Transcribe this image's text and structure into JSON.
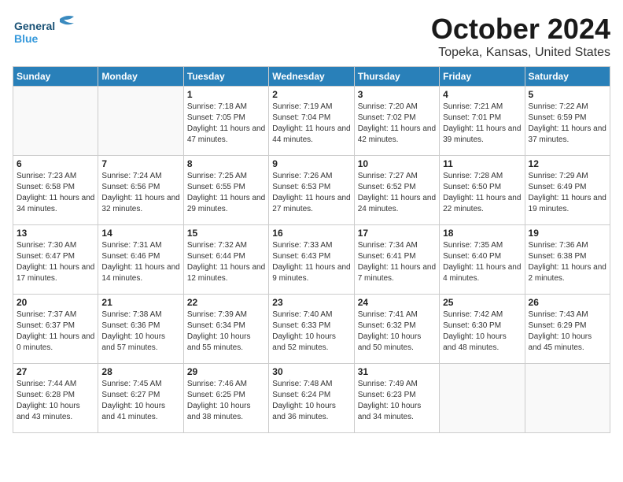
{
  "header": {
    "logo_line1": "General",
    "logo_line2": "Blue",
    "month": "October 2024",
    "location": "Topeka, Kansas, United States"
  },
  "weekdays": [
    "Sunday",
    "Monday",
    "Tuesday",
    "Wednesday",
    "Thursday",
    "Friday",
    "Saturday"
  ],
  "weeks": [
    [
      {
        "day": "",
        "info": ""
      },
      {
        "day": "",
        "info": ""
      },
      {
        "day": "1",
        "info": "Sunrise: 7:18 AM\nSunset: 7:05 PM\nDaylight: 11 hours and 47 minutes."
      },
      {
        "day": "2",
        "info": "Sunrise: 7:19 AM\nSunset: 7:04 PM\nDaylight: 11 hours and 44 minutes."
      },
      {
        "day": "3",
        "info": "Sunrise: 7:20 AM\nSunset: 7:02 PM\nDaylight: 11 hours and 42 minutes."
      },
      {
        "day": "4",
        "info": "Sunrise: 7:21 AM\nSunset: 7:01 PM\nDaylight: 11 hours and 39 minutes."
      },
      {
        "day": "5",
        "info": "Sunrise: 7:22 AM\nSunset: 6:59 PM\nDaylight: 11 hours and 37 minutes."
      }
    ],
    [
      {
        "day": "6",
        "info": "Sunrise: 7:23 AM\nSunset: 6:58 PM\nDaylight: 11 hours and 34 minutes."
      },
      {
        "day": "7",
        "info": "Sunrise: 7:24 AM\nSunset: 6:56 PM\nDaylight: 11 hours and 32 minutes."
      },
      {
        "day": "8",
        "info": "Sunrise: 7:25 AM\nSunset: 6:55 PM\nDaylight: 11 hours and 29 minutes."
      },
      {
        "day": "9",
        "info": "Sunrise: 7:26 AM\nSunset: 6:53 PM\nDaylight: 11 hours and 27 minutes."
      },
      {
        "day": "10",
        "info": "Sunrise: 7:27 AM\nSunset: 6:52 PM\nDaylight: 11 hours and 24 minutes."
      },
      {
        "day": "11",
        "info": "Sunrise: 7:28 AM\nSunset: 6:50 PM\nDaylight: 11 hours and 22 minutes."
      },
      {
        "day": "12",
        "info": "Sunrise: 7:29 AM\nSunset: 6:49 PM\nDaylight: 11 hours and 19 minutes."
      }
    ],
    [
      {
        "day": "13",
        "info": "Sunrise: 7:30 AM\nSunset: 6:47 PM\nDaylight: 11 hours and 17 minutes."
      },
      {
        "day": "14",
        "info": "Sunrise: 7:31 AM\nSunset: 6:46 PM\nDaylight: 11 hours and 14 minutes."
      },
      {
        "day": "15",
        "info": "Sunrise: 7:32 AM\nSunset: 6:44 PM\nDaylight: 11 hours and 12 minutes."
      },
      {
        "day": "16",
        "info": "Sunrise: 7:33 AM\nSunset: 6:43 PM\nDaylight: 11 hours and 9 minutes."
      },
      {
        "day": "17",
        "info": "Sunrise: 7:34 AM\nSunset: 6:41 PM\nDaylight: 11 hours and 7 minutes."
      },
      {
        "day": "18",
        "info": "Sunrise: 7:35 AM\nSunset: 6:40 PM\nDaylight: 11 hours and 4 minutes."
      },
      {
        "day": "19",
        "info": "Sunrise: 7:36 AM\nSunset: 6:38 PM\nDaylight: 11 hours and 2 minutes."
      }
    ],
    [
      {
        "day": "20",
        "info": "Sunrise: 7:37 AM\nSunset: 6:37 PM\nDaylight: 11 hours and 0 minutes."
      },
      {
        "day": "21",
        "info": "Sunrise: 7:38 AM\nSunset: 6:36 PM\nDaylight: 10 hours and 57 minutes."
      },
      {
        "day": "22",
        "info": "Sunrise: 7:39 AM\nSunset: 6:34 PM\nDaylight: 10 hours and 55 minutes."
      },
      {
        "day": "23",
        "info": "Sunrise: 7:40 AM\nSunset: 6:33 PM\nDaylight: 10 hours and 52 minutes."
      },
      {
        "day": "24",
        "info": "Sunrise: 7:41 AM\nSunset: 6:32 PM\nDaylight: 10 hours and 50 minutes."
      },
      {
        "day": "25",
        "info": "Sunrise: 7:42 AM\nSunset: 6:30 PM\nDaylight: 10 hours and 48 minutes."
      },
      {
        "day": "26",
        "info": "Sunrise: 7:43 AM\nSunset: 6:29 PM\nDaylight: 10 hours and 45 minutes."
      }
    ],
    [
      {
        "day": "27",
        "info": "Sunrise: 7:44 AM\nSunset: 6:28 PM\nDaylight: 10 hours and 43 minutes."
      },
      {
        "day": "28",
        "info": "Sunrise: 7:45 AM\nSunset: 6:27 PM\nDaylight: 10 hours and 41 minutes."
      },
      {
        "day": "29",
        "info": "Sunrise: 7:46 AM\nSunset: 6:25 PM\nDaylight: 10 hours and 38 minutes."
      },
      {
        "day": "30",
        "info": "Sunrise: 7:48 AM\nSunset: 6:24 PM\nDaylight: 10 hours and 36 minutes."
      },
      {
        "day": "31",
        "info": "Sunrise: 7:49 AM\nSunset: 6:23 PM\nDaylight: 10 hours and 34 minutes."
      },
      {
        "day": "",
        "info": ""
      },
      {
        "day": "",
        "info": ""
      }
    ]
  ]
}
